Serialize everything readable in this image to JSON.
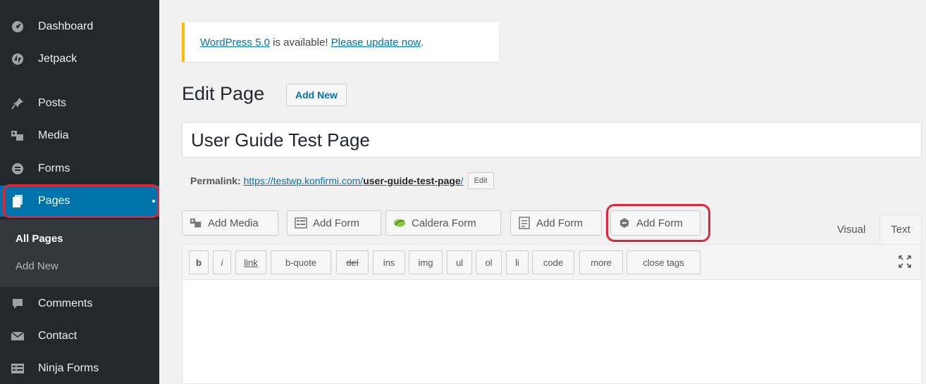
{
  "sidebar": {
    "items": [
      {
        "label": "Dashboard",
        "icon": "dashboard-icon"
      },
      {
        "label": "Jetpack",
        "icon": "jetpack-icon"
      },
      {
        "label": "Posts",
        "icon": "pin-icon"
      },
      {
        "label": "Media",
        "icon": "media-icon"
      },
      {
        "label": "Forms",
        "icon": "forms-icon"
      },
      {
        "label": "Pages",
        "icon": "pages-icon"
      },
      {
        "label": "Comments",
        "icon": "comment-icon"
      },
      {
        "label": "Contact",
        "icon": "envelope-icon"
      },
      {
        "label": "Ninja Forms",
        "icon": "ninja-forms-icon"
      }
    ],
    "submenu": [
      "All Pages",
      "Add New"
    ],
    "active_color": "#0073aa",
    "highlight_color": "#e0263a"
  },
  "notice": {
    "link1": "WordPress 5.0",
    "middle": " is available! ",
    "link2": "Please update now",
    "end": ".",
    "border_color": "#ffb900"
  },
  "heading": {
    "title": "Edit Page",
    "add_new": "Add New"
  },
  "post_title": "User Guide Test Page",
  "permalink": {
    "label": "Permalink:",
    "base": "https://testwp.konfirmi.com/",
    "slug": "user-guide-test-page",
    "trail": "/",
    "edit": "Edit"
  },
  "media_buttons": [
    {
      "label": "Add Media",
      "icon": "media-icon"
    },
    {
      "label": "Add Form",
      "icon": "form-icon"
    },
    {
      "label": "Caldera Form",
      "icon": "caldera-leaf-icon"
    },
    {
      "label": "Add Form",
      "icon": "form-doc-icon"
    },
    {
      "label": "Add Form",
      "icon": "gravity-forms-icon"
    }
  ],
  "tabs": {
    "visual": "Visual",
    "text": "Text"
  },
  "quicktags": [
    "b",
    "i",
    "link",
    "b-quote",
    "del",
    "ins",
    "img",
    "ul",
    "ol",
    "li",
    "code",
    "more",
    "close tags"
  ]
}
